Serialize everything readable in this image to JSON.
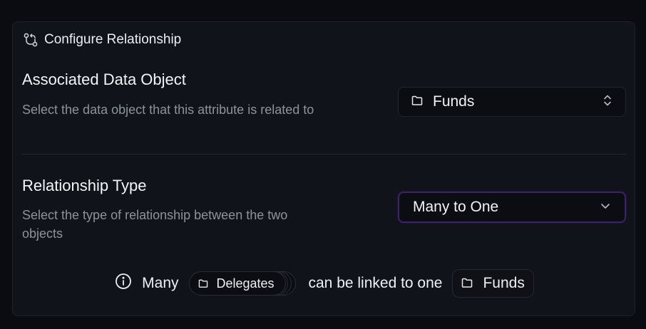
{
  "header": {
    "title": "Configure Relationship",
    "icon": "git-compare-icon"
  },
  "associated": {
    "title": "Associated Data Object",
    "description": "Select the data object that this attribute is related to",
    "selected": "Funds"
  },
  "relationship": {
    "title": "Relationship Type",
    "description": "Select the type of relationship between the two objects",
    "selected": "Many to One"
  },
  "summary": {
    "lead": "Many",
    "source_object": "Delegates",
    "middle": "can be linked to one",
    "target_object": "Funds"
  },
  "colors": {
    "background": "#0b0c11",
    "card": "#11131a",
    "focus_ring": "#3b2269"
  }
}
